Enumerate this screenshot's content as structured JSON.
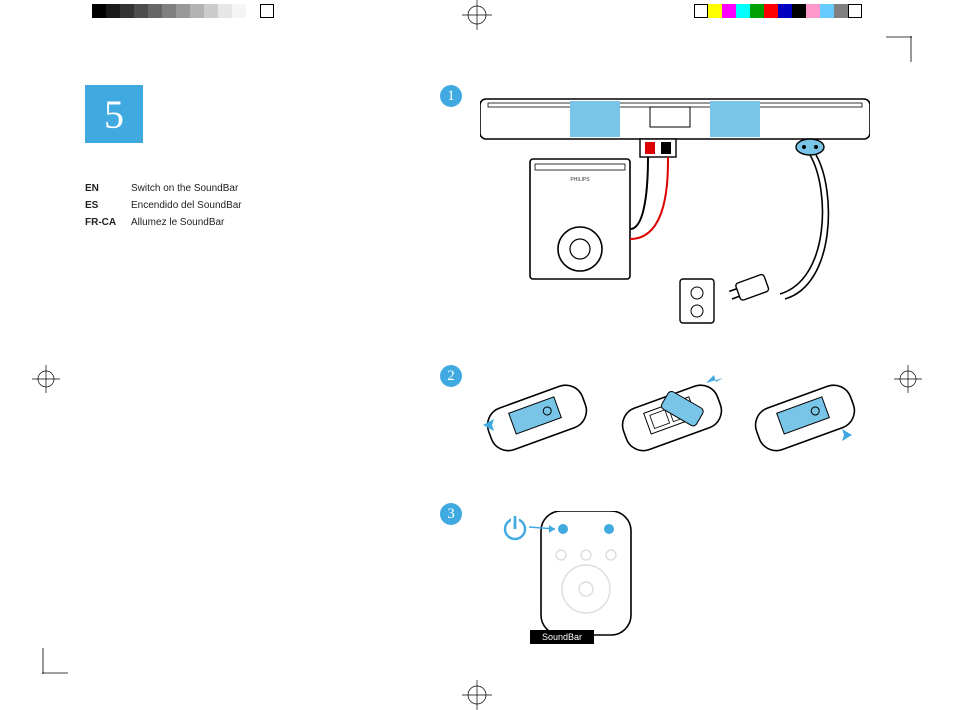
{
  "step_number": "5",
  "languages": [
    {
      "code": "EN",
      "text": "Switch on the SoundBar"
    },
    {
      "code": "ES",
      "text": "Encendido del SoundBar"
    },
    {
      "code": "FR-CA",
      "text": "Allumez le SoundBar"
    }
  ],
  "substeps": {
    "one": "1",
    "two": "2",
    "three": "3"
  },
  "remote_label": "SoundBar",
  "registration_colors_left": [
    "#000000",
    "#1a1a1a",
    "#333333",
    "#4d4d4d",
    "#666666",
    "#808080",
    "#999999",
    "#b3b3b3",
    "#cccccc",
    "#e6e6e6",
    "#f5f5f5",
    "#ffffff",
    "#ffffff"
  ],
  "registration_colors_right": [
    "#ffffff",
    "#ffff00",
    "#ff00ff",
    "#00ffff",
    "#00a000",
    "#ff0000",
    "#0000c0",
    "#000000",
    "#ff99cc",
    "#66ccff",
    "#808080",
    "#ffffff"
  ],
  "subwoofer_brand": "PHILIPS"
}
